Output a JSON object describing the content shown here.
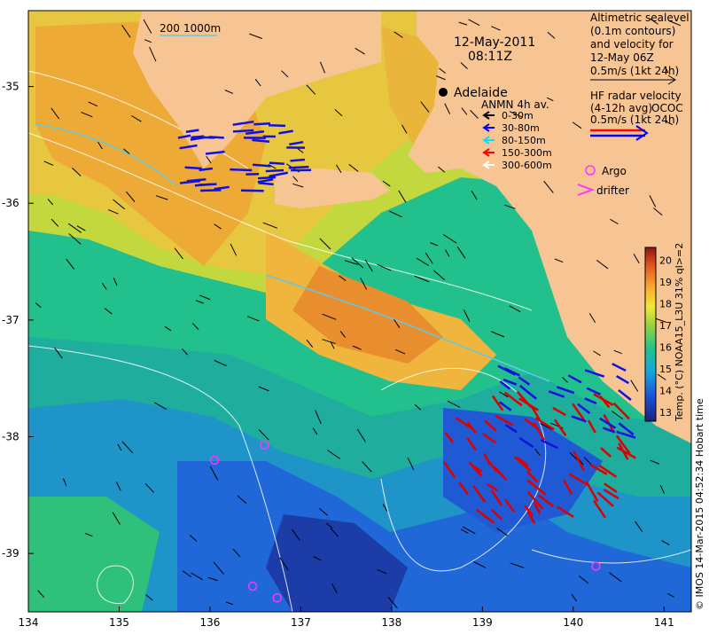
{
  "scale_bar": {
    "label_200": "200",
    "label_1000": "1000m"
  },
  "date": "12-May-2011",
  "time": "08:11Z",
  "city": {
    "name": "Adelaide"
  },
  "altimetric_legend": {
    "lines": [
      "Altimetric sealevel",
      "(0.1m contours)",
      "and velocity for",
      "12-May 06Z",
      "0.5m/s (1kt 24h)"
    ]
  },
  "hf_radar_legend": {
    "lines": [
      "HF radar velocity",
      "(4-12h avg)",
      "0.5m/s (1kt 24h)"
    ],
    "overlap_text": "OCOC"
  },
  "anmn_legend": {
    "title": "ANMN 4h av.",
    "items": [
      {
        "label": "0-30m",
        "color": "#000000"
      },
      {
        "label": "30-80m",
        "color": "#0000ff"
      },
      {
        "label": "80-150m",
        "color": "#00e5ff"
      },
      {
        "label": "150-300m",
        "color": "#ff0000"
      },
      {
        "label": "300-600m",
        "color": "#ffffff"
      }
    ]
  },
  "argo_legend": {
    "label": "Argo",
    "color": "#ff33ff"
  },
  "drifter_legend": {
    "label": "drifter",
    "color": "#ff33ff"
  },
  "axes": {
    "x_ticks": [
      "134",
      "135",
      "136",
      "137",
      "138",
      "139",
      "140",
      "141"
    ],
    "y_ticks": [
      "-35",
      "-36",
      "-37",
      "-38",
      "-39"
    ],
    "x_range": [
      134.0,
      141.3
    ],
    "y_range": [
      -39.5,
      -34.35
    ]
  },
  "colorbar": {
    "ticks": [
      "13",
      "14",
      "15",
      "16",
      "17",
      "18",
      "19",
      "20"
    ],
    "range": [
      12.6,
      20.6
    ],
    "label": "Temp. (°C) NOAA15_L3U 31% ql>=2"
  },
  "credit": "© IMOS 14-Mar-2015 04:52:34 Hobart time",
  "colors": {
    "land": "#f7c594",
    "hf_radar_red": "#ff0000",
    "hf_radar_blue": "#0000ff",
    "contour": "#ffffff",
    "cyan_contour": "#63c8e0",
    "argo_magenta": "#ff33ff"
  },
  "argo_floats": [
    {
      "lon": 136.05,
      "lat": -38.2
    },
    {
      "lon": 136.6,
      "lat": -38.07
    },
    {
      "lon": 136.47,
      "lat": -39.28
    },
    {
      "lon": 136.74,
      "lat": -39.38
    },
    {
      "lon": 140.25,
      "lat": -39.11
    }
  ]
}
